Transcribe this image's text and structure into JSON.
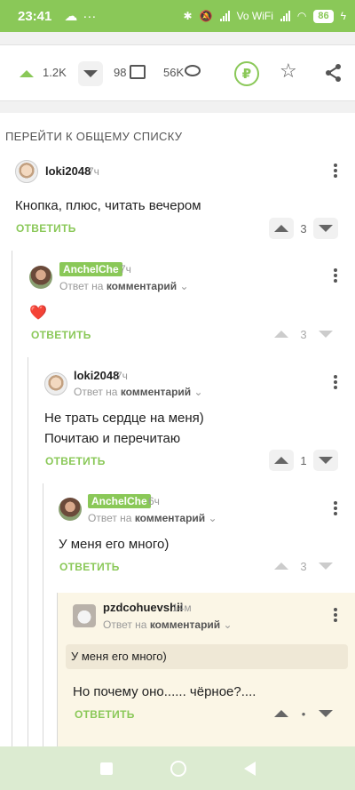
{
  "statusbar": {
    "time": "23:41",
    "dots": "···",
    "network": "Vo WiFi",
    "battery": "86"
  },
  "post_actions": {
    "likes": "1.2K",
    "comments": "98",
    "views": "56K",
    "donate_symbol": "₽",
    "star_symbol": "☆"
  },
  "back_to_list": "ПЕРЕЙТИ К ОБЩЕМУ СПИСКУ",
  "reply_prefix": "Ответ на",
  "reply_target": "комментарий",
  "reply_label": "ОТВЕТИТЬ",
  "comments": [
    {
      "author": "loki2048",
      "time": "7ч",
      "text": "Кнопка, плюс, читать вечером",
      "rating": "3"
    },
    {
      "author": "AnchelChe",
      "time": "7ч",
      "text": "❤️",
      "rating": "3"
    },
    {
      "author": "loki2048",
      "time": "7ч",
      "text_line1": "Не трать сердце на меня)",
      "text_line2": "Почитаю и перечитаю",
      "rating": "1"
    },
    {
      "author": "AnchelChe",
      "time": "6ч",
      "text": "У меня его много)",
      "rating": "3"
    },
    {
      "author": "pzdcohuevshii",
      "time": "14м",
      "quote": "У меня его много)",
      "text": "Но почему оно...... чёрное?....",
      "rating": "•"
    }
  ],
  "colors": {
    "accent": "#8ac858",
    "highlight": "#fbf6e6"
  }
}
